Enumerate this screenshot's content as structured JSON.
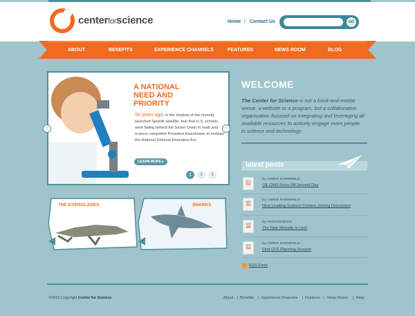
{
  "brand": {
    "name_bold": "center",
    "name_light": "for",
    "name_tail": "science"
  },
  "header_links": [
    "Home",
    "Contact Us"
  ],
  "header_sep": "|",
  "search": {
    "placeholder": "",
    "button": "GO"
  },
  "nav": [
    "ABOUT",
    "BENEFITS",
    "EXPERIENCE CHANNELS",
    "FEATURES",
    "NEWS ROOM",
    "BLOG"
  ],
  "hero": {
    "title_line1": "A NATIONAL",
    "title_line2": "NEED AND",
    "title_line3": "PRIORITY",
    "year": "50 years ago,",
    "body": " in the shadow of the recently launched Sputnik satellite, fear that U.S. schools were failing behind the Soviet Union in math and science compelled President Eisenhower to institute the National Defense Education Act.",
    "button": "LEARN MORE ▸",
    "pages": [
      "1",
      "2",
      "3"
    ]
  },
  "cards": [
    {
      "label": "THE EVERGLADES"
    },
    {
      "label": "SHARKS"
    }
  ],
  "welcome": {
    "title": "WELCOME",
    "lead": "The Center for Science",
    "body": " is not a brick-and-mortar venue, a website or a program, but a collaborative organization focused on integrating and leveraging all available resources to actively engage more people in science and technology."
  },
  "latest": {
    "title": "latest posts",
    "posts": [
      {
        "month": "OCT",
        "day": "02",
        "by": "by CHRIS DORNFELD",
        "title": "GE CMO Kicks Off Second Day"
      },
      {
        "month": "SEP",
        "day": "30",
        "by": "by CHRIS DORNFELD",
        "title": "Nine Leading Science Centers Joining Discussion"
      },
      {
        "month": "SEP",
        "day": "28",
        "by": "by PARADOWSKI",
        "title": "The New Website Is Live!"
      },
      {
        "month": "SEP",
        "day": "04",
        "by": "by CHRIS DORNFELD",
        "title": "First CFS Planning Session"
      }
    ],
    "rss": "RSS Feed"
  },
  "footer": {
    "copyright": "©2010 Copyright ",
    "org": "Center for Science",
    "links": [
      "About",
      "Benefits",
      "Experience Channels",
      "Features",
      "News Room",
      "Blog"
    ],
    "sep": "|"
  },
  "colors": {
    "accent": "#f06a1f",
    "teal": "#4f8f98",
    "bg": "#9fc4cb"
  }
}
